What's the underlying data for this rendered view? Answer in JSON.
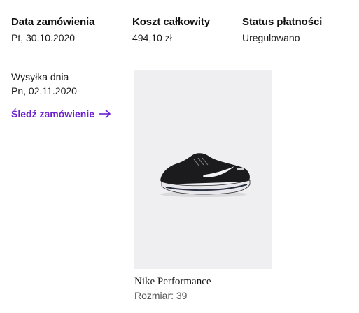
{
  "order": {
    "date_label": "Data zamówienia",
    "date_value": "Pt, 30.10.2020",
    "total_label": "Koszt całkowity",
    "total_value": "494,10 zł",
    "payment_label": "Status płatności",
    "payment_value": "Uregulowano"
  },
  "shipping": {
    "label": "Wysyłka dnia",
    "date": "Pn, 02.11.2020"
  },
  "tracking": {
    "link_label": "Śledź zamówienie",
    "icon": "arrow-right-icon",
    "color": "#6b1fd1"
  },
  "product": {
    "brand": "Nike Performance",
    "size": "Rozmiar: 39",
    "image_icon": "sneaker-image",
    "image_bg": "#efeff1"
  }
}
